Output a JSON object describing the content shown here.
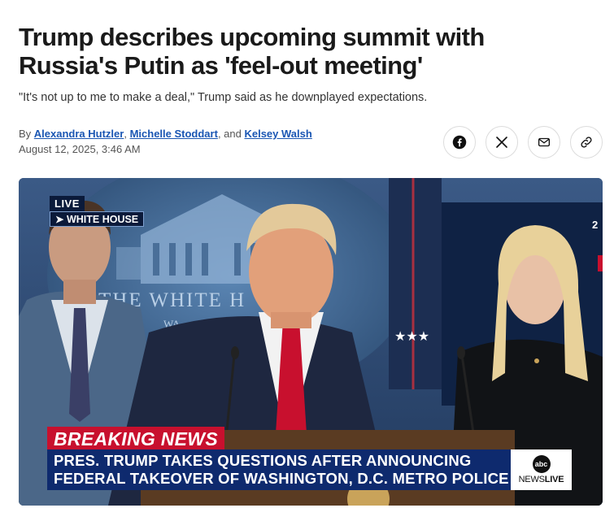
{
  "article": {
    "headline": "Trump describes upcoming summit with Russia's Putin as 'feel-out meeting'",
    "dek": "\"It's not up to me to make a deal,\" Trump said as he downplayed expectations.",
    "byline": {
      "prefix": "By ",
      "authors": [
        "Alexandra Hutzler",
        "Michelle Stoddart",
        "Kelsey Walsh"
      ],
      "sep1": ", ",
      "sep2": ", and "
    },
    "date": "August 12, 2025, 3:46 AM"
  },
  "share": [
    {
      "name": "facebook",
      "icon": "facebook-icon"
    },
    {
      "name": "x",
      "icon": "x-icon"
    },
    {
      "name": "email",
      "icon": "mail-icon"
    },
    {
      "name": "copy-link",
      "icon": "link-icon"
    }
  ],
  "video": {
    "live_label": "LIVE",
    "location_label": "➤ WHITE HOUSE",
    "backdrop_text": "THE WHITE H",
    "backdrop_text2": "WA",
    "breaking_label": "BREAKING NEWS",
    "ticker_line1": "PRES. TRUMP TAKES QUESTIONS AFTER ANNOUNCING",
    "ticker_line2": "FEDERAL TAKEOVER OF WASHINGTON, D.C. METRO POLICE",
    "logo_text": "abc",
    "network_label_news": "NEWS",
    "network_label_live": "LIVE",
    "edge_number": "2"
  },
  "colors": {
    "link": "#1a56b3",
    "breaking_red": "#c8102e",
    "ticker_blue": "#0e2a6e"
  }
}
